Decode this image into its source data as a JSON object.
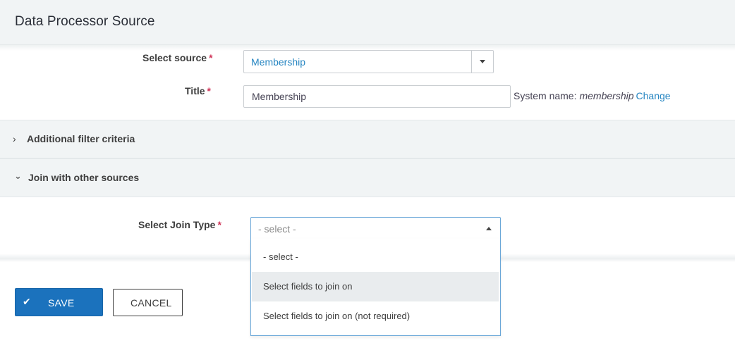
{
  "header": {
    "title": "Data Processor Source"
  },
  "form": {
    "source_label": "Select source",
    "source_value": "Membership",
    "title_label": "Title",
    "title_value": "Membership",
    "system_name_label": "System name:",
    "system_name_value": "membership",
    "change_link": "Change",
    "required_mark": "*"
  },
  "accordions": [
    {
      "label": "Additional filter criteria",
      "state": "collapsed",
      "icon": "chevron-right-icon"
    },
    {
      "label": "Join with other sources",
      "state": "expanded",
      "icon": "chevron-down-icon"
    }
  ],
  "join": {
    "label": "Select Join Type",
    "selected": "- select -",
    "options": [
      {
        "label": "- select -",
        "highlighted": false
      },
      {
        "label": "Select fields to join on",
        "highlighted": true
      },
      {
        "label": "Select fields to join on (not required)",
        "highlighted": false
      }
    ]
  },
  "buttons": {
    "save": "SAVE",
    "cancel": "CANCEL"
  },
  "colors": {
    "primary": "#1b72bd",
    "link": "#2786c2",
    "required": "#cf3458",
    "panel": "#f1f4f5"
  }
}
